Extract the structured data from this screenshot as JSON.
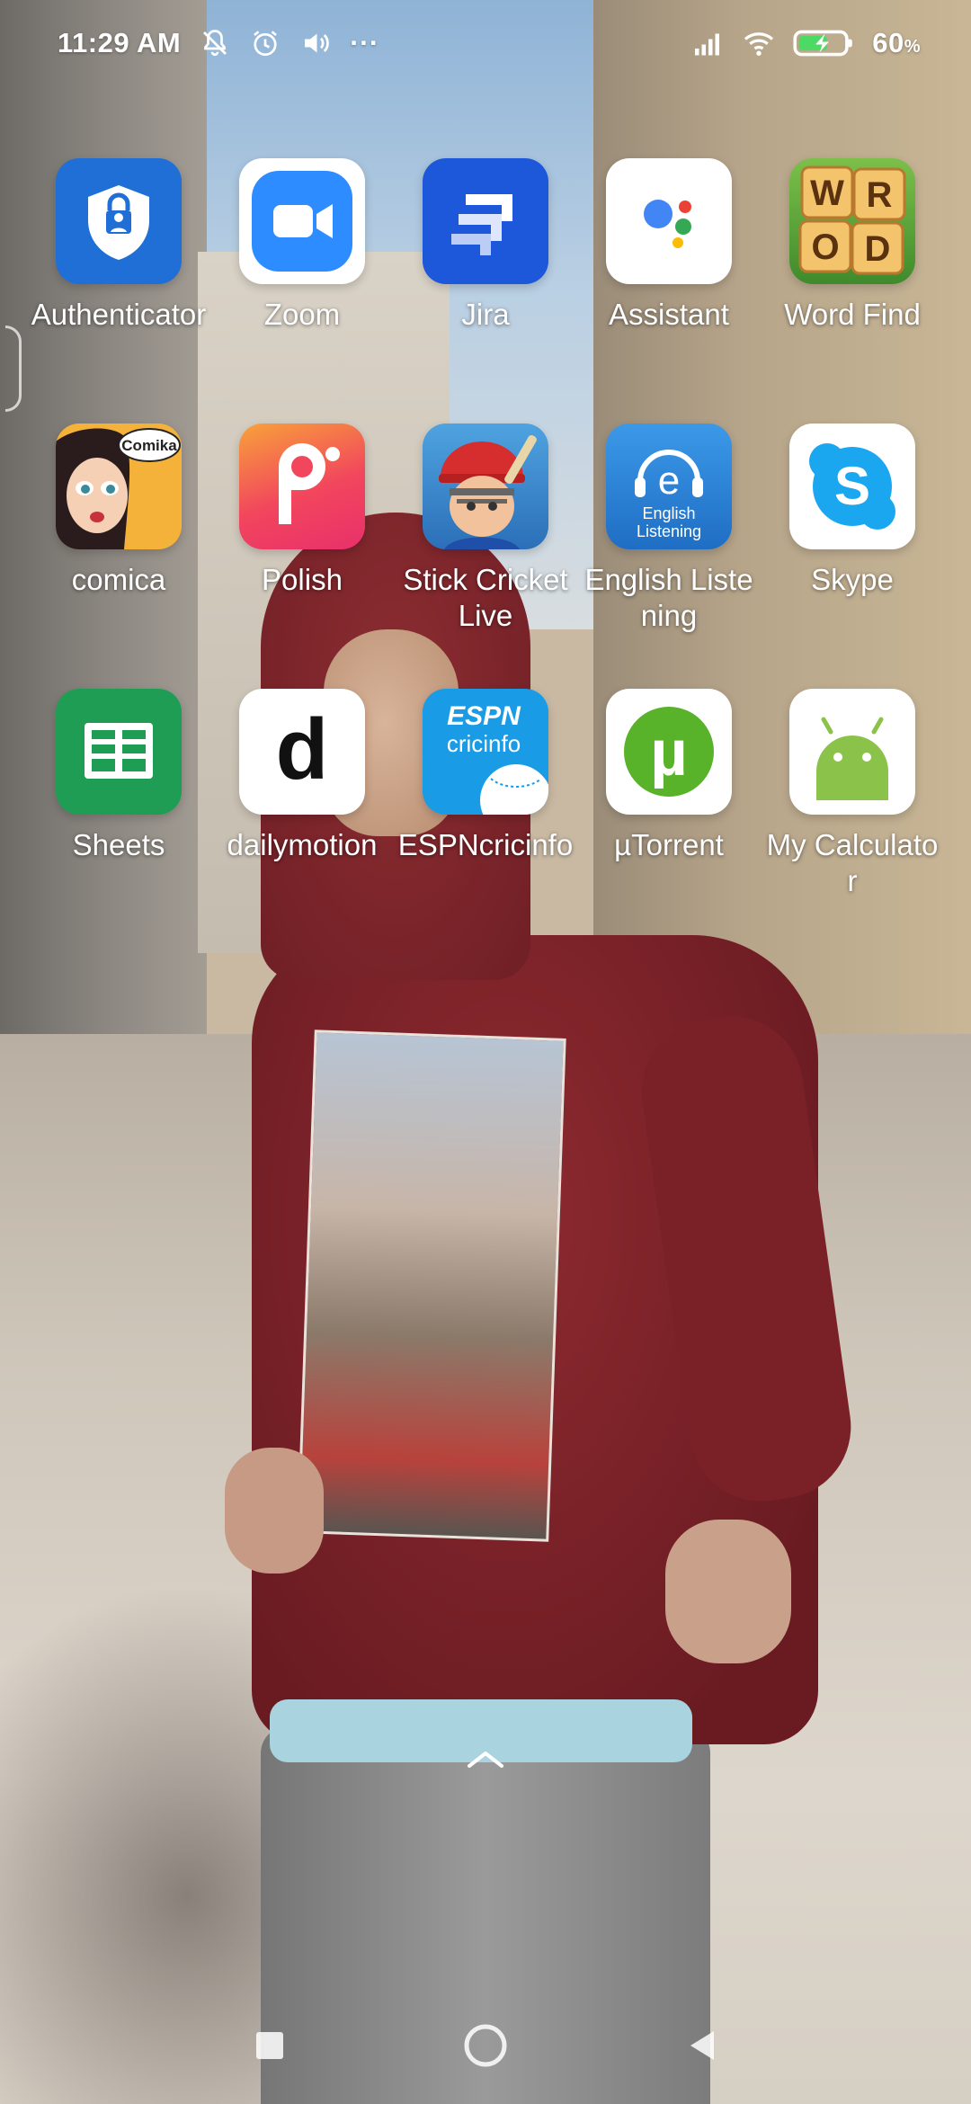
{
  "status_bar": {
    "time": "11:29 AM",
    "more_indicator": "···",
    "battery_percent": "60",
    "battery_unit": "%",
    "icons": [
      "notifications-muted-icon",
      "alarm-icon",
      "volume-icon",
      "signal-icon",
      "wifi-icon",
      "battery-charging-icon"
    ]
  },
  "apps": [
    {
      "label": "Authenticator",
      "icon": "authenticator-icon"
    },
    {
      "label": "Zoom",
      "icon": "zoom-icon"
    },
    {
      "label": "Jira",
      "icon": "jira-icon"
    },
    {
      "label": "Assistant",
      "icon": "assistant-icon"
    },
    {
      "label": "Word Find",
      "icon": "word-find-icon"
    },
    {
      "label": "comica",
      "icon": "comica-icon"
    },
    {
      "label": "Polish",
      "icon": "polish-icon"
    },
    {
      "label": "Stick Cricket Live",
      "icon": "stick-cricket-icon"
    },
    {
      "label": "English Listening",
      "icon": "english-listening-icon"
    },
    {
      "label": "Skype",
      "icon": "skype-icon"
    },
    {
      "label": "Sheets",
      "icon": "sheets-icon"
    },
    {
      "label": "dailymotion",
      "icon": "dailymotion-icon"
    },
    {
      "label": "ESPNcricinfo",
      "icon": "espncricinfo-icon"
    },
    {
      "label": "µTorrent",
      "icon": "utorrent-icon"
    },
    {
      "label": "My Calculator",
      "icon": "android-icon"
    }
  ],
  "icon_text": {
    "word_find_letters": [
      "W",
      "R",
      "O",
      "D"
    ],
    "comica_badge": "Comika",
    "english_listening_caption_1": "English",
    "english_listening_caption_2": "Listening",
    "espn_logo": "ESPN",
    "espn_sub": "cricinfo",
    "dailymotion_letter": "d",
    "utorrent_letter": "µ",
    "skype_letter": "S",
    "english_listening_letter": "e"
  },
  "colors": {
    "authenticator": "#1f6fd6",
    "zoom": "#2d8cff",
    "jira": "#1c58d9",
    "polish": "#f2465d",
    "english_listening": "#2b83d6",
    "skype": "#1aa7f0",
    "sheets": "#1f9d55",
    "espn": "#1a9be6",
    "utorrent": "#58b32a",
    "android": "#8bc34a"
  },
  "nav": {
    "buttons": [
      "recents-button",
      "home-button",
      "back-button"
    ]
  }
}
